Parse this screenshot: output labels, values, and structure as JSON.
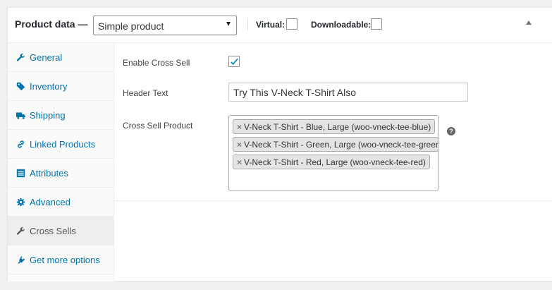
{
  "header": {
    "title": "Product data —",
    "product_type": "Simple product",
    "virtual_label": "Virtual:",
    "virtual_checked": false,
    "downloadable_label": "Downloadable:",
    "downloadable_checked": false,
    "collapse_icon": "triangle-up-icon"
  },
  "tabs": [
    {
      "label": "General",
      "icon": "wrench-icon",
      "active": false
    },
    {
      "label": "Inventory",
      "icon": "tag-icon",
      "active": false
    },
    {
      "label": "Shipping",
      "icon": "truck-icon",
      "active": false
    },
    {
      "label": "Linked Products",
      "icon": "link-icon",
      "active": false
    },
    {
      "label": "Attributes",
      "icon": "list-icon",
      "active": false
    },
    {
      "label": "Advanced",
      "icon": "gear-icon",
      "active": false
    },
    {
      "label": "Cross Sells",
      "icon": "wrench-icon",
      "active": true
    },
    {
      "label": "Get more options",
      "icon": "plugin-icon",
      "active": false
    }
  ],
  "cross_sells": {
    "enable_label": "Enable Cross Sell",
    "enable_checked": true,
    "header_text_label": "Header Text",
    "header_text_value": "Try This V-Neck T-Shirt Also",
    "products_label": "Cross Sell Product",
    "selected_products": [
      {
        "remove": "×",
        "label": "V-Neck T-Shirt - Blue, Large (woo-vneck-tee-blue)"
      },
      {
        "remove": "×",
        "label": "V-Neck T-Shirt - Green, Large (woo-vneck-tee-green)"
      },
      {
        "remove": "×",
        "label": "V-Neck T-Shirt - Red, Large (woo-vneck-tee-red)"
      }
    ],
    "help_icon": "?"
  },
  "colors": {
    "link": "#0073aa",
    "active_tab_bg": "#eeeeee",
    "chip_bg": "#e4e4e4"
  }
}
